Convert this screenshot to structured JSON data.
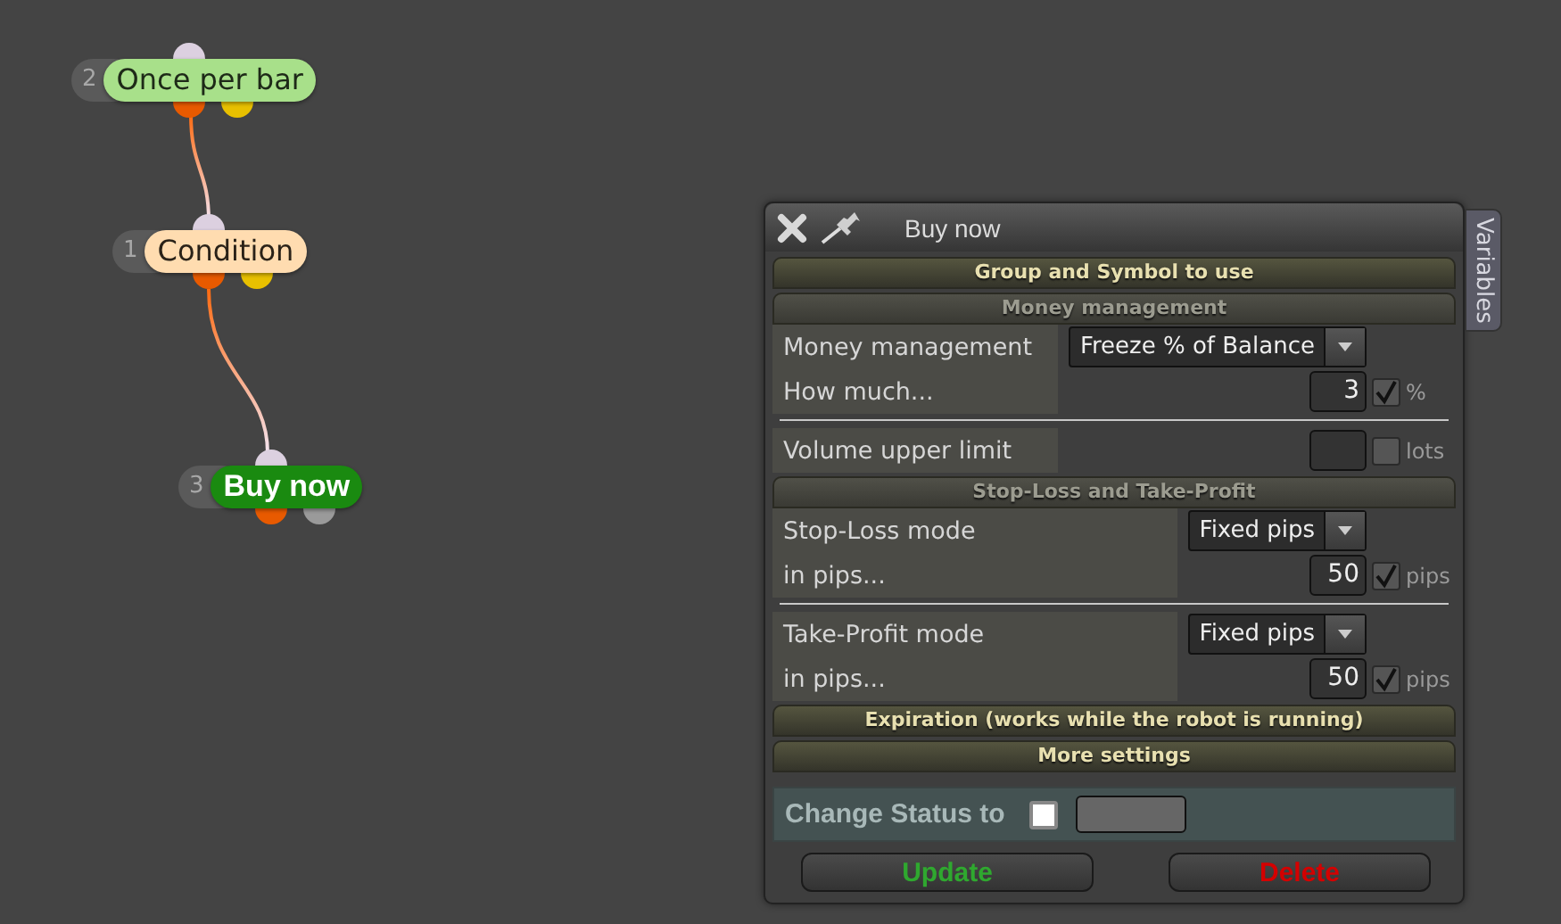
{
  "nodes": [
    {
      "number": "2",
      "label": "Once per bar",
      "color": "#a8e08a",
      "kind": "filter",
      "ports": [
        {
          "color": "#e85a00"
        },
        {
          "color": "#e8c000"
        }
      ]
    },
    {
      "number": "1",
      "label": "Condition",
      "color": "#ffdcb0",
      "kind": "condition",
      "ports": [
        {
          "color": "#e85a00"
        },
        {
          "color": "#e8c000"
        }
      ]
    },
    {
      "number": "3",
      "label": "Buy now",
      "color": "#1a8a10",
      "kind": "action",
      "ports": [
        {
          "color": "#e85a00"
        },
        {
          "color": "#9a9a9a"
        }
      ]
    }
  ],
  "panel": {
    "title": "Buy now",
    "side_tab": "Variables",
    "sections": [
      {
        "title": "Group and Symbol to use",
        "expanded": false
      },
      {
        "title": "Money management",
        "expanded": true,
        "groups": [
          {
            "rows": [
              {
                "kind": "select",
                "label": "Money management",
                "value": "Freeze % of Balance"
              },
              {
                "kind": "number",
                "label": "How much...",
                "value": "3",
                "checked": true,
                "unit": "%"
              }
            ]
          },
          {
            "rows": [
              {
                "kind": "number",
                "label": "Volume upper limit",
                "checked": false,
                "unit": "lots"
              }
            ]
          }
        ]
      },
      {
        "title": "Stop-Loss and Take-Profit",
        "expanded": true,
        "groups": [
          {
            "rows": [
              {
                "kind": "select",
                "label": "Stop-Loss mode",
                "value": "Fixed pips"
              },
              {
                "kind": "number",
                "label": "in pips...",
                "value": "50",
                "checked": true,
                "unit": "pips"
              }
            ]
          },
          {
            "rows": [
              {
                "kind": "select",
                "label": "Take-Profit mode",
                "value": "Fixed pips"
              },
              {
                "kind": "number",
                "label": "in pips...",
                "value": "50",
                "checked": true,
                "unit": "pips"
              }
            ]
          }
        ]
      },
      {
        "title": "Expiration (works while the robot is running)",
        "expanded": false
      },
      {
        "title": "More settings",
        "expanded": false
      }
    ],
    "status": {
      "label": "Change Status to",
      "checked": false
    },
    "buttons": [
      {
        "label": "Update",
        "kind": "update"
      },
      {
        "label": "Delete",
        "kind": "delete"
      }
    ]
  }
}
